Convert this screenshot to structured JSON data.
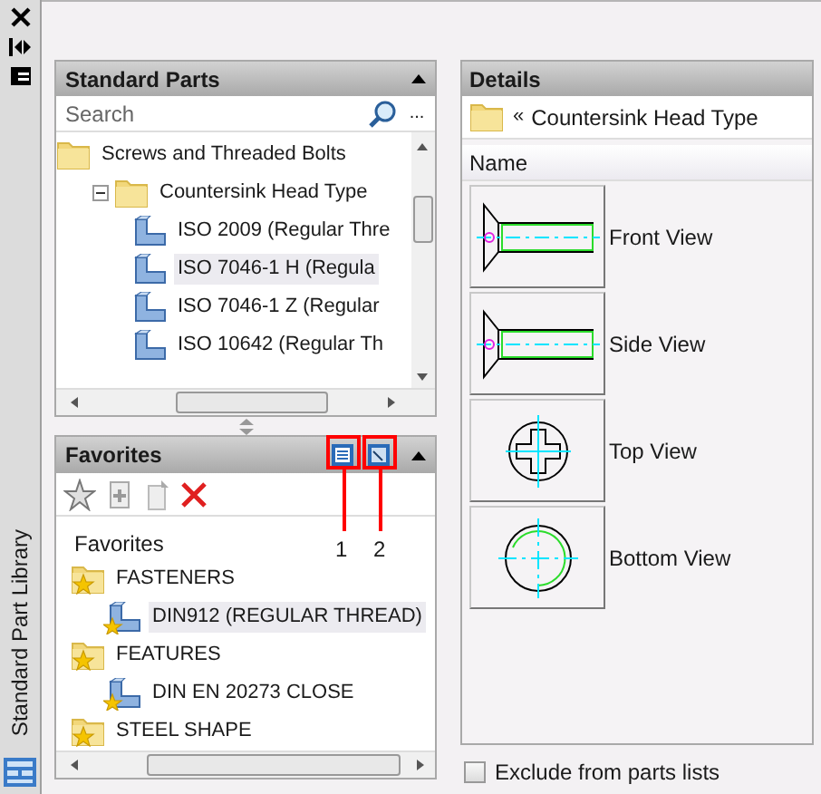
{
  "palette": {
    "title": "Standard Part Library"
  },
  "standard_parts": {
    "title": "Standard Parts",
    "search": {
      "placeholder": "Search"
    },
    "more_button": "...",
    "tree": [
      {
        "label": "Screws and Threaded Bolts",
        "kind": "folder",
        "selected": false,
        "children": [
          {
            "label": "Countersink Head Type",
            "kind": "folder",
            "expanded": true,
            "selected": false,
            "children": [
              {
                "label": "ISO 2009  (Regular Thre",
                "kind": "part",
                "selected": false
              },
              {
                "label": "ISO 7046-1  H  (Regula",
                "kind": "part",
                "selected": true
              },
              {
                "label": "ISO 7046-1  Z  (Regular",
                "kind": "part",
                "selected": false
              },
              {
                "label": "ISO 10642  (Regular Th",
                "kind": "part",
                "selected": false
              }
            ]
          }
        ]
      }
    ]
  },
  "favorites": {
    "title": "Favorites",
    "root": "Favorites",
    "items": [
      {
        "label": "FASTENERS",
        "kind": "folder",
        "selected": false,
        "children": [
          {
            "label": "DIN912 (REGULAR THREAD)",
            "kind": "part",
            "selected": true
          }
        ]
      },
      {
        "label": "FEATURES",
        "kind": "folder",
        "selected": false,
        "children": [
          {
            "label": "DIN EN 20273 CLOSE",
            "kind": "part",
            "selected": false
          }
        ]
      },
      {
        "label": "STEEL SHAPE",
        "kind": "folder",
        "selected": false
      }
    ],
    "callouts": [
      "1",
      "2"
    ]
  },
  "details": {
    "title": "Details",
    "path": "Countersink Head Type",
    "path_prefix": "«",
    "column": "Name",
    "views": [
      {
        "label": "Front View",
        "kind": "side"
      },
      {
        "label": "Side View",
        "kind": "side"
      },
      {
        "label": "Top View",
        "kind": "top"
      },
      {
        "label": "Bottom View",
        "kind": "bottom"
      }
    ],
    "exclude": {
      "label": "Exclude from parts lists",
      "checked": false
    }
  }
}
